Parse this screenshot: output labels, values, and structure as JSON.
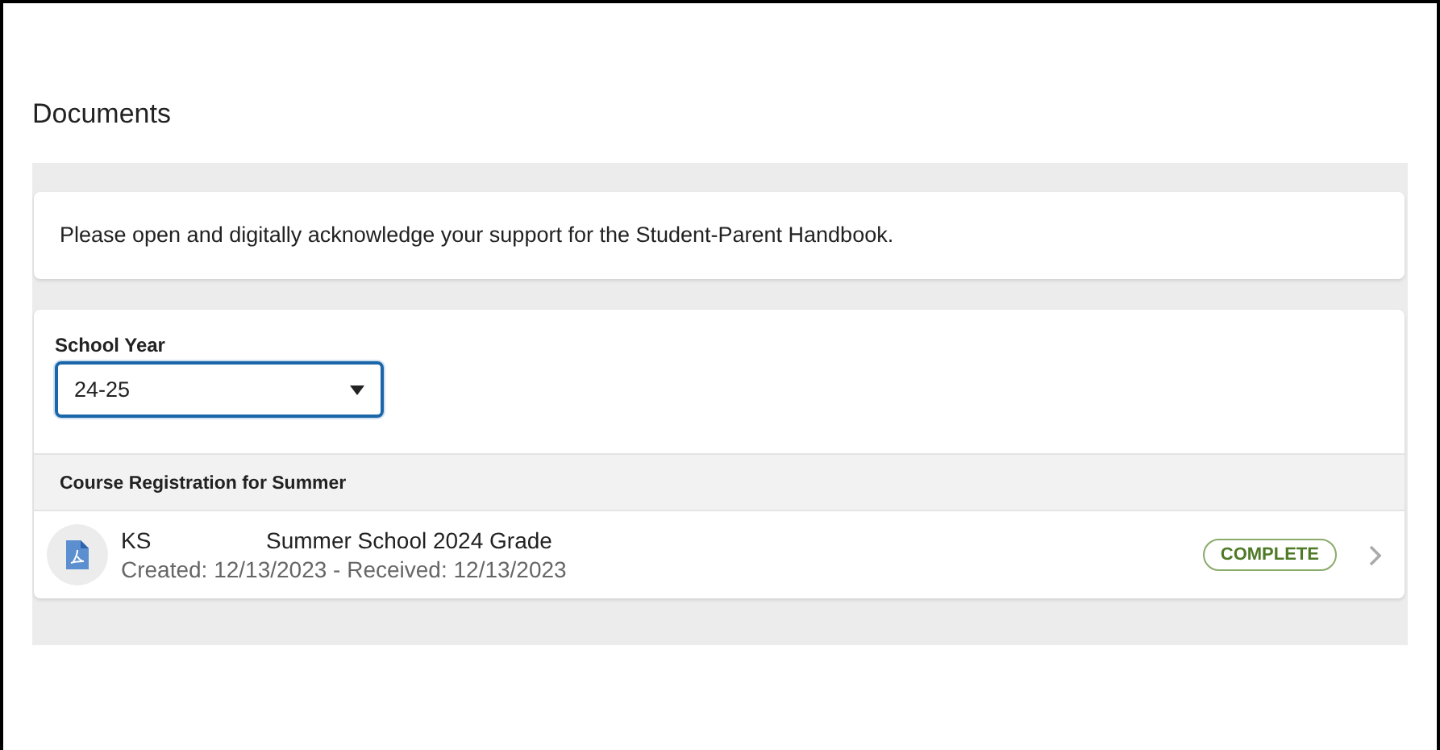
{
  "page_title": "Documents",
  "notice": "Please open and digitally acknowledge your support for the Student-Parent Handbook.",
  "school_year": {
    "label": "School Year",
    "value": "24-25"
  },
  "sections": [
    {
      "title": "Course Registration for Summer",
      "documents": [
        {
          "code": "KS",
          "name": "Summer School 2024 Grade",
          "dates": "Created: 12/13/2023 - Received: 12/13/2023",
          "status": "COMPLETE"
        }
      ]
    }
  ]
}
